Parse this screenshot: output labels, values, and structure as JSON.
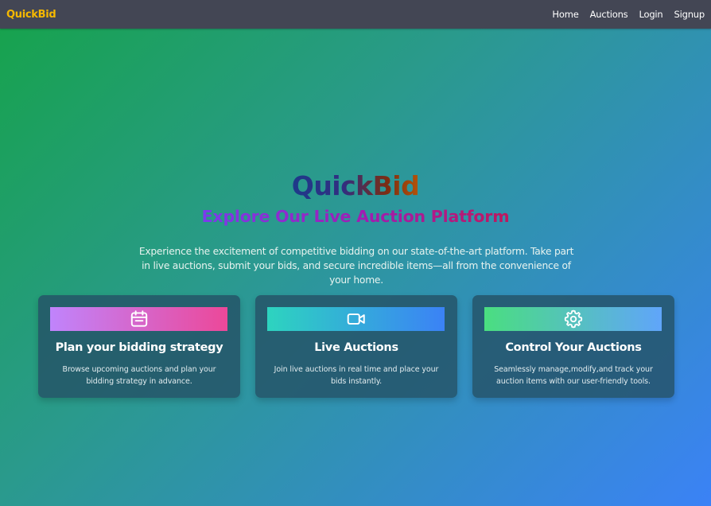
{
  "nav": {
    "brand": "QuickBid",
    "links": [
      "Home",
      "Auctions",
      "Login",
      "Signup"
    ]
  },
  "hero": {
    "title": "QuickBid",
    "subtitle": "Explore Our Live Auction Platform",
    "description": "Experience the excitement of competitive bidding on our state-of-the-art platform. Take part in live auctions, submit your bids, and secure incredible items—all from the convenience of your home."
  },
  "cards": [
    {
      "icon": "calendar-icon",
      "title": "Plan your bidding strategy",
      "description": "Browse upcoming auctions and plan your bidding strategy in advance.",
      "gradient": [
        "#c084fc",
        "#ec4899"
      ]
    },
    {
      "icon": "video-icon",
      "title": "Live Auctions",
      "description": "Join live auctions in real time and place your bids instantly.",
      "gradient": [
        "#2dd4bf",
        "#3b82f6"
      ]
    },
    {
      "icon": "gear-icon",
      "title": "Control Your Auctions",
      "description": "Seamlessly manage,modify,and track your auction items with our user-friendly tools.",
      "gradient": [
        "#4ade80",
        "#60a5fa"
      ]
    }
  ],
  "colors": {
    "navbar": "#434654",
    "brand": "#f5b800",
    "background_start": "#16a34a",
    "background_end": "#3b82f6"
  }
}
